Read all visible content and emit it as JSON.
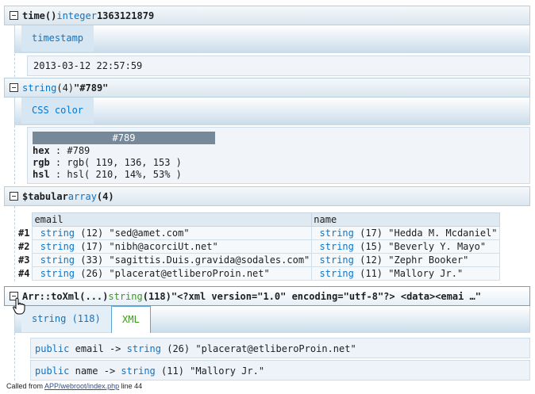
{
  "time_section": {
    "name": "time()",
    "type": "integer",
    "value": "1363121879",
    "tab_label": "timestamp",
    "formatted": "2013-03-12 22:57:59"
  },
  "color_section": {
    "type": "string",
    "length": "(4)",
    "value": "\"#789\"",
    "tab_label": "CSS color",
    "swatch_text": "#789",
    "swatch_color": "#778899",
    "hex_label": "hex",
    "hex_value": ": #789",
    "rgb_label": "rgb",
    "rgb_value": ": rgb( 119, 136, 153 )",
    "hsl_label": "hsl",
    "hsl_value": ": hsl( 210, 14%, 53% )"
  },
  "tabular_section": {
    "name": "$tabular",
    "type": "array",
    "count": "(4)",
    "columns": [
      "email",
      "name"
    ],
    "rows": [
      {
        "index": "#1",
        "email_type": "string",
        "email_len": "(12)",
        "email": "\"sed@amet.com\"",
        "name_type": "string",
        "name_len": "(17)",
        "name": "\"Hedda M. Mcdaniel\""
      },
      {
        "index": "#2",
        "email_type": "string",
        "email_len": "(17)",
        "email": "\"nibh@acorciUt.net\"",
        "name_type": "string",
        "name_len": "(15)",
        "name": "\"Beverly Y. Mayo\""
      },
      {
        "index": "#3",
        "email_type": "string",
        "email_len": "(33)",
        "email": "\"sagittis.Duis.gravida@sodales.com\"",
        "name_type": "string",
        "name_len": "(12)",
        "name": "\"Zephr Booker\""
      },
      {
        "index": "#4",
        "email_type": "string",
        "email_len": "(26)",
        "email": "\"placerat@etliberoProin.net\"",
        "name_type": "string",
        "name_len": "(11)",
        "name": "\"Mallory Jr.\""
      }
    ]
  },
  "xml_section": {
    "name": "Arr::toXml(...)",
    "type": "string",
    "length": "(118)",
    "value": "\"<?xml version=\"1.0\" encoding=\"utf-8\"?> <data><emai …\"",
    "tabs": [
      "string (118)",
      "XML"
    ],
    "properties": [
      {
        "visibility": "public",
        "name": "email",
        "arrow": "->",
        "type": "string",
        "length": "(26)",
        "value": "\"placerat@etliberoProin.net\""
      },
      {
        "visibility": "public",
        "name": "name",
        "arrow": "->",
        "type": "string",
        "length": "(11)",
        "value": "\"Mallory Jr.\""
      }
    ]
  },
  "footer": {
    "prefix": "Called from",
    "path": "APP/webroot/index.php",
    "suffix": "line 44"
  }
}
